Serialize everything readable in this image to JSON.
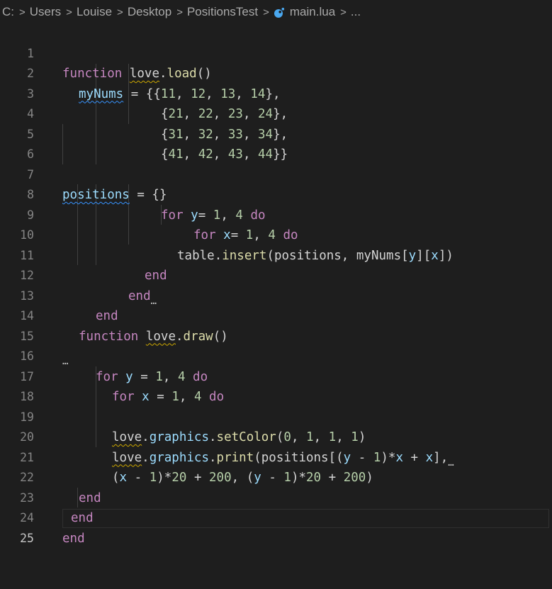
{
  "breadcrumb": {
    "items": [
      "C:",
      "Users",
      "Louise",
      "Desktop",
      "PositionsTest"
    ],
    "file": "main.lua",
    "more": "...",
    "separator": ">"
  },
  "editor": {
    "current_line": "25",
    "line_numbers": [
      "1",
      "2",
      "3",
      "4",
      "5",
      "6",
      "7",
      "8",
      "9",
      "10",
      "11",
      "12",
      "13",
      "14",
      "15",
      "16",
      "17",
      "18",
      "19",
      "20",
      "21",
      "22",
      "23",
      "24",
      "25"
    ],
    "lines": [
      "function love.load()",
      "myNums = {{11, 12, 13, 14},",
      "{21, 22, 23, 24},",
      "{31, 32, 33, 34},",
      "{41, 42, 43, 44}}",
      "",
      "positions = {}",
      "for y= 1, 4 do",
      "for x= 1, 4 do",
      "table.insert(positions, myNums[y][x])",
      "end",
      "end",
      "end",
      "function love.draw()",
      "",
      "for y = 1, 4 do",
      "for x = 1, 4 do",
      "",
      "love.graphics.setColor(0, 1, 1, 1)",
      "love.graphics.print(positions[(y - 1)*x + x],",
      "(x - 1)*20 + 200, (y - 1)*20 + 200)",
      "end",
      "end",
      "end",
      ""
    ],
    "fold_ellipsis": "…",
    "colors": {
      "keyword": "#c586c0",
      "function": "#dcdcaa",
      "number": "#b5cea8",
      "variable": "#9cdcfe",
      "text": "#d4d4d4",
      "line_number": "#858585",
      "background": "#1e1e1e"
    }
  }
}
